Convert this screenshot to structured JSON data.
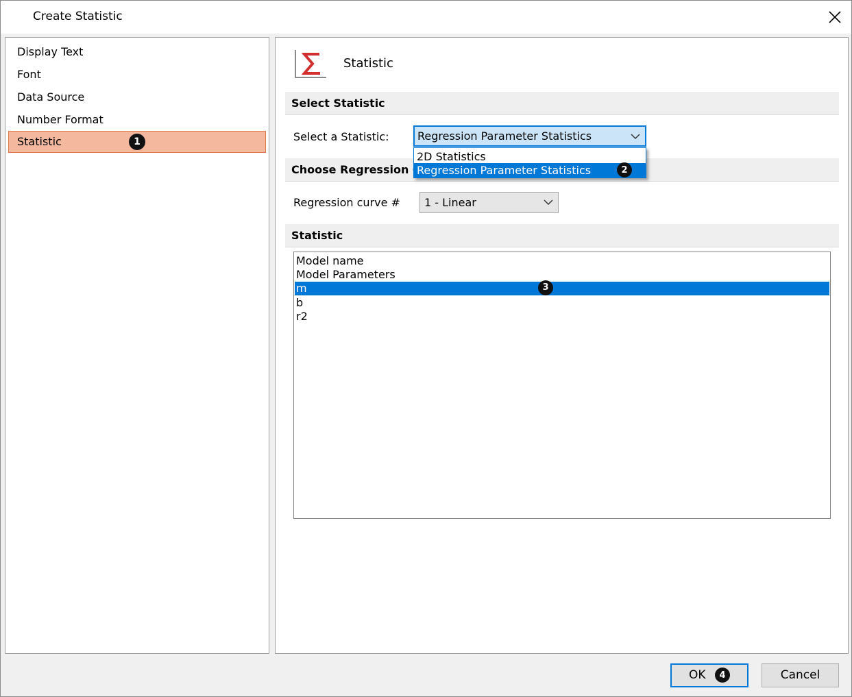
{
  "window": {
    "title": "Create Statistic"
  },
  "nav": {
    "items": [
      {
        "label": "Display Text"
      },
      {
        "label": "Font"
      },
      {
        "label": "Data Source"
      },
      {
        "label": "Number Format"
      },
      {
        "label": "Statistic",
        "badge": "1"
      }
    ]
  },
  "header": {
    "title": "Statistic",
    "icon": "sigma-icon"
  },
  "select_section": {
    "heading": "Select Statistic",
    "label": "Select a Statistic:",
    "value": "Regression Parameter Statistics",
    "options": [
      "2D Statistics",
      "Regression Parameter Statistics"
    ],
    "options_badge": "2"
  },
  "regression_section": {
    "heading_visible": "Choose Regression Cu",
    "label": "Regression curve #",
    "value": "1 - Linear"
  },
  "statistic_section": {
    "heading": "Statistic",
    "items": [
      "Model name",
      "Model Parameters",
      "m",
      "b",
      "r2"
    ],
    "selected_index": 2,
    "badge": "3"
  },
  "buttons": {
    "ok": "OK",
    "ok_badge": "4",
    "cancel": "Cancel"
  },
  "colors": {
    "accent": "#0078d7",
    "nav_selected": "#f4b89e",
    "sigma": "#d32f2f"
  }
}
